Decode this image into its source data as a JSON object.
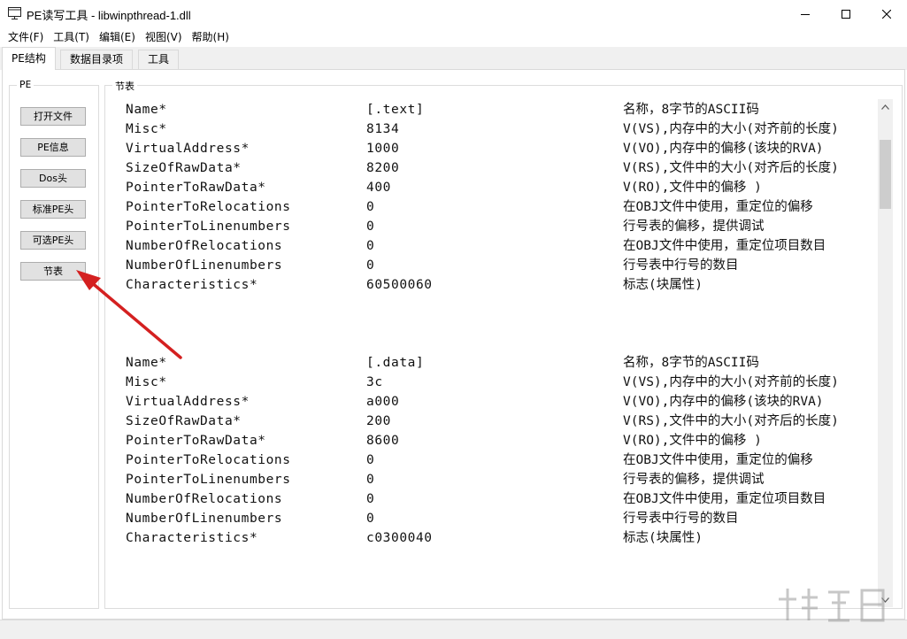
{
  "window": {
    "title": "PE读写工具 - libwinpthread-1.dll"
  },
  "menu": {
    "items": [
      {
        "label": "文件(F)"
      },
      {
        "label": "工具(T)"
      },
      {
        "label": "编辑(E)"
      },
      {
        "label": "视图(V)"
      },
      {
        "label": "帮助(H)"
      }
    ]
  },
  "tabs": [
    {
      "label": "PE结构",
      "active": true
    },
    {
      "label": "数据目录项",
      "active": false
    },
    {
      "label": "工具",
      "active": false
    }
  ],
  "pe_group": {
    "legend": "PE",
    "buttons": [
      {
        "label": "打开文件"
      },
      {
        "label": "PE信息"
      },
      {
        "label": "Dos头"
      },
      {
        "label": "标准PE头"
      },
      {
        "label": "可选PE头"
      },
      {
        "label": "节表"
      }
    ]
  },
  "section_group": {
    "legend": "节表"
  },
  "sections": [
    {
      "rows": [
        {
          "name": "Name*",
          "value": "[.text]",
          "desc": "名称，8字节的ASCII码"
        },
        {
          "name": "Misc*",
          "value": "8134",
          "desc": "V(VS),内存中的大小(对齐前的长度)"
        },
        {
          "name": "VirtualAddress*",
          "value": "1000",
          "desc": "V(VO),内存中的偏移(该块的RVA)"
        },
        {
          "name": "SizeOfRawData*",
          "value": "8200",
          "desc": "V(RS),文件中的大小(对齐后的长度)"
        },
        {
          "name": "PointerToRawData*",
          "value": "400",
          "desc": "V(RO),文件中的偏移  )"
        },
        {
          "name": "PointerToRelocations",
          "value": "0",
          "desc": "在OBJ文件中使用，重定位的偏移"
        },
        {
          "name": "PointerToLinenumbers",
          "value": "0",
          "desc": "行号表的偏移，提供调试"
        },
        {
          "name": "NumberOfRelocations",
          "value": "0",
          "desc": "在OBJ文件中使用，重定位项目数目"
        },
        {
          "name": "NumberOfLinenumbers",
          "value": "0",
          "desc": "行号表中行号的数目"
        },
        {
          "name": "Characteristics*",
          "value": "60500060",
          "desc": "标志(块属性)"
        }
      ]
    },
    {
      "rows": [
        {
          "name": "Name*",
          "value": "[.data]",
          "desc": "名称，8字节的ASCII码"
        },
        {
          "name": "Misc*",
          "value": "3c",
          "desc": "V(VS),内存中的大小(对齐前的长度)"
        },
        {
          "name": "VirtualAddress*",
          "value": "a000",
          "desc": "V(VO),内存中的偏移(该块的RVA)"
        },
        {
          "name": "SizeOfRawData*",
          "value": "200",
          "desc": "V(RS),文件中的大小(对齐后的长度)"
        },
        {
          "name": "PointerToRawData*",
          "value": "8600",
          "desc": "V(RO),文件中的偏移  )"
        },
        {
          "name": "PointerToRelocations",
          "value": "0",
          "desc": "在OBJ文件中使用，重定位的偏移"
        },
        {
          "name": "PointerToLinenumbers",
          "value": "0",
          "desc": "行号表的偏移，提供调试"
        },
        {
          "name": "NumberOfRelocations",
          "value": "0",
          "desc": "在OBJ文件中使用，重定位项目数目"
        },
        {
          "name": "NumberOfLinenumbers",
          "value": "0",
          "desc": "行号表中行号的数目"
        },
        {
          "name": "Characteristics*",
          "value": "c0300040",
          "desc": "标志(块属性)"
        }
      ]
    }
  ],
  "icons": {
    "app": "window-app-icon",
    "minimize": "minimize-icon",
    "maximize": "maximize-icon",
    "close": "close-icon",
    "annotation": "red-arrow-icon",
    "watermark": "watermark-logo"
  },
  "colors": {
    "annotation_arrow": "#d42020",
    "button_face": "#e1e1e1",
    "tab_strip": "#f0f0f0"
  }
}
